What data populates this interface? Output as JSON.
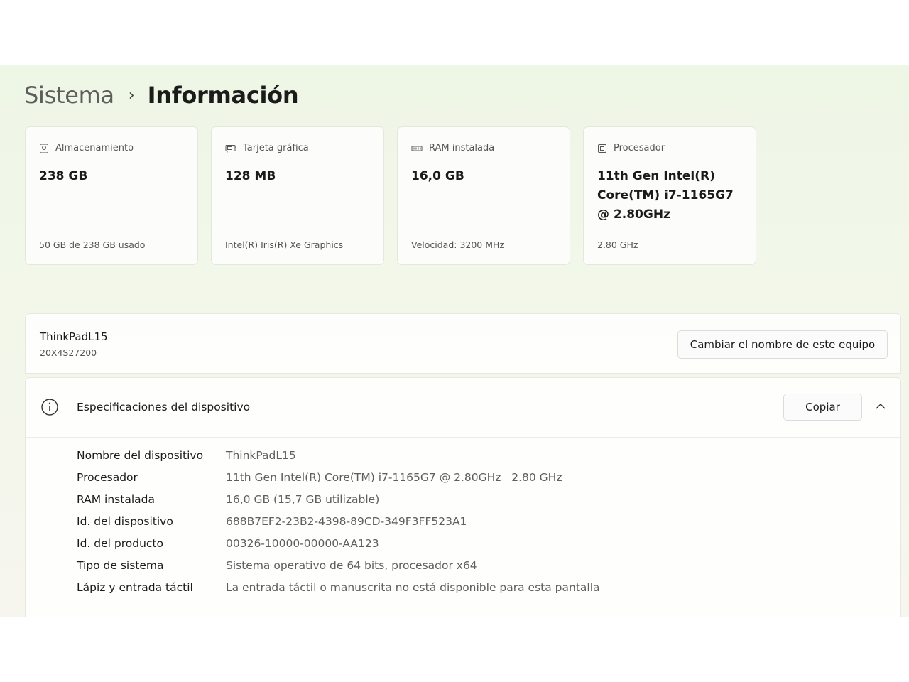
{
  "breadcrumb": {
    "parent": "Sistema",
    "separator": "›",
    "current": "Información"
  },
  "cards": [
    {
      "label": "Almacenamiento",
      "icon": "storage-icon",
      "value": "238 GB",
      "footer": "50 GB de 238 GB usado"
    },
    {
      "label": "Tarjeta gráfica",
      "icon": "gpu-icon",
      "value": "128 MB",
      "footer": "Intel(R) Iris(R) Xe Graphics"
    },
    {
      "label": "RAM instalada",
      "icon": "ram-icon",
      "value": "16,0 GB",
      "footer": "Velocidad: 3200 MHz"
    },
    {
      "label": "Procesador",
      "icon": "cpu-icon",
      "value": "11th Gen Intel(R) Core(TM) i7-1165G7 @ 2.80GHz",
      "footer": "2.80 GHz"
    }
  ],
  "device": {
    "name": "ThinkPadL15",
    "model": "20X4S27200",
    "rename_label": "Cambiar el nombre de este equipo"
  },
  "specs": {
    "title": "Especificaciones del dispositivo",
    "copy_label": "Copiar",
    "rows": [
      {
        "label": "Nombre del dispositivo",
        "value": "ThinkPadL15"
      },
      {
        "label": "Procesador",
        "value": "11th Gen Intel(R) Core(TM) i7-1165G7 @ 2.80GHz   2.80 GHz"
      },
      {
        "label": "RAM instalada",
        "value": "16,0 GB (15,7 GB utilizable)"
      },
      {
        "label": "Id. del dispositivo",
        "value": "688B7EF2-23B2-4398-89CD-349F3FF523A1"
      },
      {
        "label": "Id. del producto",
        "value": "00326-10000-00000-AA123"
      },
      {
        "label": "Tipo de sistema",
        "value": "Sistema operativo de 64 bits, procesador x64"
      },
      {
        "label": "Lápiz y entrada táctil",
        "value": "La entrada táctil o manuscrita no está disponible para esta pantalla"
      }
    ]
  }
}
